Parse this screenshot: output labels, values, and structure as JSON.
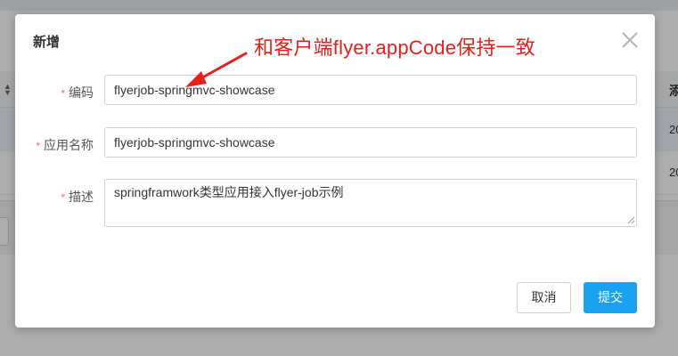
{
  "background": {
    "column_header_right": "添",
    "row_cells_right": [
      "20",
      "20"
    ]
  },
  "modal": {
    "title": "新增",
    "form": {
      "code": {
        "required_mark": "*",
        "label": "编码",
        "value": "flyerjob-springmvc-showcase"
      },
      "name": {
        "required_mark": "*",
        "label": "应用名称",
        "value": "flyerjob-springmvc-showcase"
      },
      "description": {
        "required_mark": "*",
        "label": "描述",
        "value": "springframwork类型应用接入flyer-job示例"
      }
    },
    "buttons": {
      "cancel": "取消",
      "submit": "提交"
    }
  },
  "annotation": {
    "text": "和客户端flyer.appCode保持一致",
    "color": "#e8201c"
  },
  "colors": {
    "primary": "#1aa1f0",
    "required": "#f56c6c"
  },
  "icons": [
    "close-icon",
    "sort-icon",
    "arrow-icon",
    "resize-grip-icon"
  ]
}
